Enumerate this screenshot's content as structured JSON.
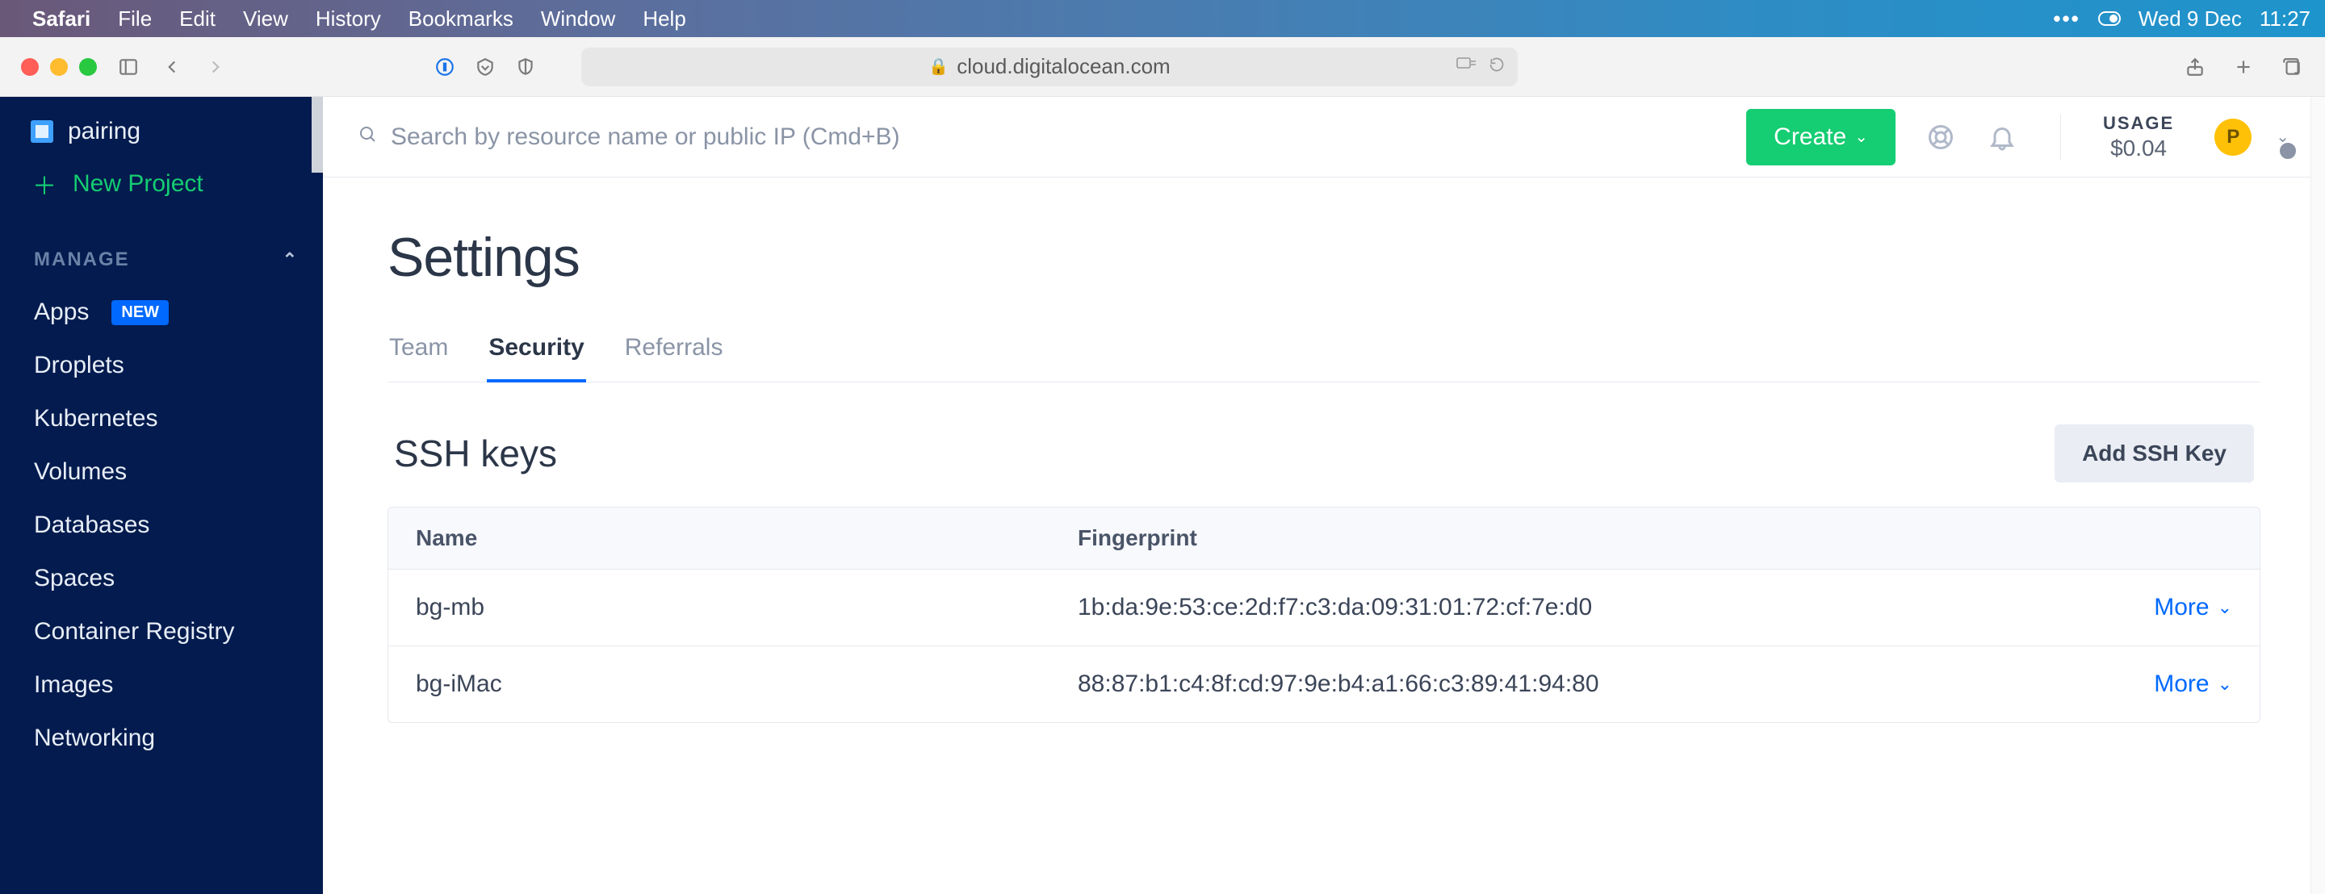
{
  "menubar": {
    "app": "Safari",
    "items": [
      "File",
      "Edit",
      "View",
      "History",
      "Bookmarks",
      "Window",
      "Help"
    ],
    "date": "Wed 9 Dec",
    "time": "11:27"
  },
  "browser": {
    "url": "cloud.digitalocean.com"
  },
  "sidebar": {
    "project": "pairing",
    "new_project": "New Project",
    "section": "MANAGE",
    "items": [
      {
        "label": "Apps",
        "badge": "NEW"
      },
      {
        "label": "Droplets"
      },
      {
        "label": "Kubernetes"
      },
      {
        "label": "Volumes"
      },
      {
        "label": "Databases"
      },
      {
        "label": "Spaces"
      },
      {
        "label": "Container Registry"
      },
      {
        "label": "Images"
      },
      {
        "label": "Networking"
      }
    ]
  },
  "topbar": {
    "search_placeholder": "Search by resource name or public IP (Cmd+B)",
    "create": "Create",
    "usage_label": "USAGE",
    "usage_amount": "$0.04",
    "avatar_initial": "P"
  },
  "page": {
    "title": "Settings",
    "tabs": [
      "Team",
      "Security",
      "Referrals"
    ],
    "active_tab": 1,
    "section_title": "SSH keys",
    "add_key": "Add SSH Key",
    "table": {
      "headers": {
        "name": "Name",
        "fingerprint": "Fingerprint"
      },
      "rows": [
        {
          "name": "bg-mb",
          "fingerprint": "1b:da:9e:53:ce:2d:f7:c3:da:09:31:01:72:cf:7e:d0",
          "more": "More"
        },
        {
          "name": "bg-iMac",
          "fingerprint": "88:87:b1:c4:8f:cd:97:9e:b4:a1:66:c3:89:41:94:80",
          "more": "More"
        }
      ]
    }
  }
}
